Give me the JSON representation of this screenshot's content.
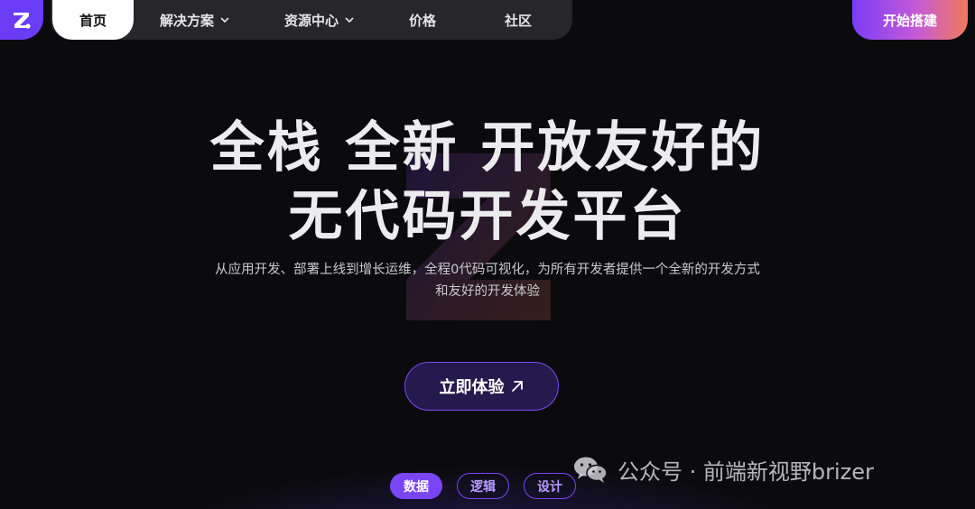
{
  "colors": {
    "brand": "#6b3cf5",
    "accent": "#7a45f5",
    "cta_gradient": [
      "#7b3cf7",
      "#c45ad8",
      "#f07a5a"
    ],
    "background": "#0b0b0e"
  },
  "header": {
    "logo_icon": "brand-logo-icon",
    "nav": [
      {
        "label": "首页",
        "active": true,
        "dropdown": false
      },
      {
        "label": "解决方案",
        "active": false,
        "dropdown": true
      },
      {
        "label": "资源中心",
        "active": false,
        "dropdown": true
      },
      {
        "label": "价格",
        "active": false,
        "dropdown": false
      },
      {
        "label": "社区",
        "active": false,
        "dropdown": false
      }
    ],
    "cta_label": "开始搭建"
  },
  "hero": {
    "title_line1": "全栈 全新 开放友好的",
    "title_line2": "无代码开发平台",
    "subtitle_line1": "从应用开发、部署上线到增长运维，全程0代码可视化，为所有开发者提供一个全新的开发方式",
    "subtitle_line2": "和友好的开发体验",
    "cta_label": "立即体验",
    "cta_icon": "arrow-up-right-icon"
  },
  "tabs": [
    {
      "label": "数据",
      "active": true
    },
    {
      "label": "逻辑",
      "active": false
    },
    {
      "label": "设计",
      "active": false
    }
  ],
  "watermark": {
    "icon": "wechat-icon",
    "text": "公众号 · 前端新视野brizer"
  }
}
